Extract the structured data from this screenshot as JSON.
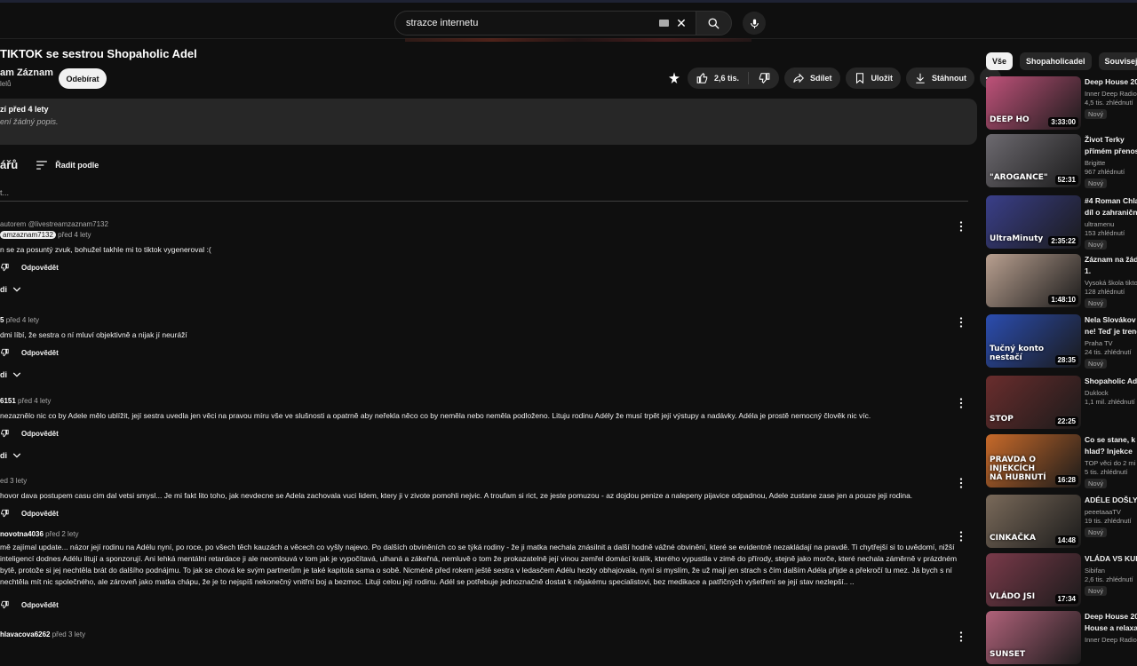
{
  "search": {
    "value": "strazce internetu"
  },
  "video": {
    "title": "TIKTOK se sestrou Shopaholic Adel",
    "channel": "am Záznam",
    "subs": "lelů",
    "subscribe_label": "Odebírat",
    "likes": "2,6 tis.",
    "share_label": "Sdílet",
    "save_label": "Uložit",
    "download_label": "Stáhnout"
  },
  "description": {
    "meta": "zí  před 4 lety",
    "text": "ení žádný popis."
  },
  "comments": {
    "count_label": "ářů",
    "sort_label": "Řadit podle",
    "add_placeholder": "t...",
    "reply_label": "Odpovědět",
    "items": [
      {
        "pinned": "autorem @livestreamzaznam7132",
        "author": "amzaznam7132",
        "date": "před 4 lety",
        "text": "n se za posuntý zvuk, bohužel takhle mi to tiktok vygeneroval :(",
        "replies": "di"
      },
      {
        "author": "5",
        "date": "před 4 lety",
        "text": "dmi líbí, že sestra o ní mluví objektivně a nijak jí neuráží",
        "replies": "di"
      },
      {
        "author": "6151",
        "date": "před 4 lety",
        "text": "nezaznělo nic co by Adele mělo ublížit, její sestra uvedla jen věci na pravou míru vše ve slušnosti a opatrně aby neřekla něco co by neměla nebo neměla podloženo. Lituju rodinu Adély že musí trpět její výstupy a nadávky. Adéla je prostě nemocný člověk nic víc.",
        "replies": "di"
      },
      {
        "author": "",
        "date": "ed 3 lety",
        "text": "hovor dava postupem casu cim dal vetsi smysl... Je mi fakt lito toho, jak nevdecne se Adela zachovala vuci lidem, ktery ji v zivote pomohli nejvic. A troufam si rict, ze jeste pomuzou - az dojdou penize a nalepeny pijavice odpadnou, Adele zustane zase jen a pouze jeji rodina."
      },
      {
        "author": "novotna4036",
        "date": "před 2 lety",
        "text": "mě zajímal update... názor její rodinu na Adélu nyní, po roce, po všech těch kauzách a věcech co vyšly najevo. Po dalších obviněních co se týká rodiny - že ji matka nechala znásilnit a další hodně vážné obvinění, které se evidentně nezakládají na pravdě. Ti chytřejší si to uvědomí, nižší inteligencí dodnes Adélu litují a sponzorují. Ani lehká mentální retardace ji ale neomlouvá v tom jak je vypočítavá, ulhaná a zákeřná, nemluvě o tom že prokazatelně její vinou zemřel  domácí králík, kterého vypustila v zimě do přírody, stejně jako morče, které nechala záměrně v prázdném bytě, protože si jej nechtěla brát do dalšího podnájmu. To jak se chová ke svým partnerům je také kapitola sama o sobě. Nicméně před rokem ještě sestra v ledasčem Adélu hezky obhajovala, nyní si myslím, že už mají jen strach s čím dalším Adéla přijde a překročí tu mez. Já bych s ní nechtěla mít nic společného, ale zároveň jako matka chápu, že je to nejspíš nekonečný vnitřní boj a bezmoc. Lituji celou její rodinu. Adél se potřebuje jednoznačně dostat k nějakému specialistovi, bez medikace a patřičných vyšetření se její stav nezlepší.. .."
      },
      {
        "author": "hlavacova6262",
        "date": "před 3 lety",
        "text": ""
      }
    ]
  },
  "chips": [
    "Vše",
    "Shopaholicadel",
    "Související"
  ],
  "recommendations": [
    {
      "title1": "Deep House 20",
      "title2": "",
      "channel": "Inner Deep Radio",
      "meta": "4,5 tis. zhlédnutí",
      "badge": "Nový",
      "duration": "3:33:00",
      "thumb_text": "DEEP HO",
      "bg": "#c0527a"
    },
    {
      "title1": "Život Terky",
      "title2": "přímém přenos",
      "channel": "Brigitte",
      "meta": "967 zhlédnutí",
      "badge": "Nový",
      "duration": "52:31",
      "thumb_text": "\"AROGANCE\"",
      "bg": "#6d6a70"
    },
    {
      "title1": "#4 Roman Chla",
      "title2": "díl o zahraniční",
      "channel": "ultramenu",
      "meta": "153 zhlédnutí",
      "badge": "Nový",
      "duration": "2:35:22",
      "thumb_text": "UltraMinuty",
      "bg": "#3a3f8a"
    },
    {
      "title1": "Záznam na žád",
      "title2": "1.",
      "channel": "Vysoká škola tikto",
      "meta": "128 zhlédnutí",
      "badge": "Nový",
      "duration": "1:48:10",
      "thumb_text": "",
      "bg": "#b9a090"
    },
    {
      "title1": "Nela Slovákov",
      "title2": "ne! Teď je trend",
      "channel": "Praha TV",
      "meta": "24 tis. zhlédnutí",
      "badge": "Nový",
      "duration": "28:35",
      "thumb_text": "Tučný konto nestačí",
      "bg": "#2b4db0"
    },
    {
      "title1": "Shopaholic Ad",
      "title2": "",
      "channel": "Duklock",
      "meta": "1,1 mil. zhlédnutí",
      "badge": "",
      "duration": "22:25",
      "thumb_text": "STOP",
      "bg": "#6a2d2d"
    },
    {
      "title1": "Co se stane, k",
      "title2": "hlad? Injekce",
      "channel": "TOP věci do 2 mi",
      "meta": "5 tis. zhlédnutí",
      "badge": "Nový",
      "duration": "16:28",
      "thumb_text": "PRAVDA O INJEKCÍCH NA HUBNUTÍ",
      "bg": "#c86a2a"
    },
    {
      "title1": "ADÉLE DOŠLY",
      "title2": "",
      "channel": "peeetaaaTV",
      "meta": "19 tis. zhlédnutí",
      "badge": "Nový",
      "duration": "14:48",
      "thumb_text": "CINKAČKA",
      "bg": "#7a6a5a"
    },
    {
      "title1": "VLÁDA VS KUE",
      "title2": "",
      "channel": "Sibifan",
      "meta": "2,6 tis. zhlédnutí",
      "badge": "Nový",
      "duration": "17:34",
      "thumb_text": "VLÁDO JSI",
      "bg": "#7a3a4a"
    },
    {
      "title1": "Deep House 20",
      "title2": "House a relaxa",
      "channel": "Inner Deep Radio",
      "meta": "",
      "badge": "",
      "duration": "",
      "thumb_text": "SUNSET",
      "bg": "#b0627a"
    }
  ]
}
